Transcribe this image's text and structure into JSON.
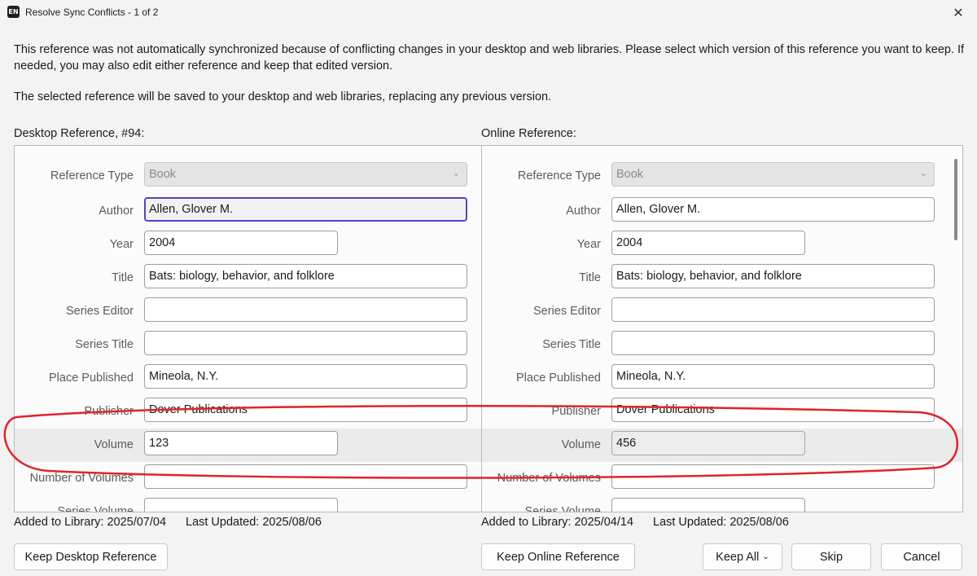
{
  "window": {
    "app_icon": "EN",
    "title": "Resolve Sync Conflicts - 1 of 2",
    "close_glyph": "✕"
  },
  "intro": {
    "paragraph1": "This reference was not automatically synchronized because of conflicting changes in your desktop and web libraries. Please select which version of this reference you want to keep. If needed, you may also edit either reference and keep that edited version.",
    "paragraph2": "The selected reference will be saved to your desktop and web libraries, replacing any previous version."
  },
  "desktop": {
    "header": "Desktop Reference, #94:",
    "fields": {
      "reference_type": {
        "label": "Reference Type",
        "value": "Book"
      },
      "author": {
        "label": "Author",
        "value": "Allen, Glover M."
      },
      "year": {
        "label": "Year",
        "value": "2004"
      },
      "title": {
        "label": "Title",
        "value": "Bats: biology, behavior, and folklore"
      },
      "series_editor": {
        "label": "Series Editor",
        "value": ""
      },
      "series_title": {
        "label": "Series Title",
        "value": ""
      },
      "place_published": {
        "label": "Place Published",
        "value": "Mineola, N.Y."
      },
      "publisher": {
        "label": "Publisher",
        "value": "Dover Publications"
      },
      "volume": {
        "label": "Volume",
        "value": "123"
      },
      "number_of_volumes": {
        "label": "Number of Volumes",
        "value": ""
      },
      "series_volume": {
        "label": "Series Volume",
        "value": ""
      }
    },
    "added": "Added to Library: 2025/07/04",
    "updated": "Last Updated: 2025/08/06"
  },
  "online": {
    "header": "Online Reference:",
    "fields": {
      "reference_type": {
        "label": "Reference Type",
        "value": "Book"
      },
      "author": {
        "label": "Author",
        "value": "Allen, Glover M."
      },
      "year": {
        "label": "Year",
        "value": "2004"
      },
      "title": {
        "label": "Title",
        "value": "Bats: biology, behavior, and folklore"
      },
      "series_editor": {
        "label": "Series Editor",
        "value": ""
      },
      "series_title": {
        "label": "Series Title",
        "value": ""
      },
      "place_published": {
        "label": "Place Published",
        "value": "Mineola, N.Y."
      },
      "publisher": {
        "label": "Publisher",
        "value": "Dover Publications"
      },
      "volume": {
        "label": "Volume",
        "value": "456"
      },
      "number_of_volumes": {
        "label": "Number of Volumes",
        "value": ""
      },
      "series_volume": {
        "label": "Series Volume",
        "value": ""
      }
    },
    "added": "Added to Library: 2025/04/14",
    "updated": "Last Updated: 2025/08/06"
  },
  "buttons": {
    "keep_desktop": "Keep Desktop Reference",
    "keep_online": "Keep Online Reference",
    "keep_all": "Keep All",
    "skip": "Skip",
    "cancel": "Cancel"
  },
  "colors": {
    "annotation": "#e0232a",
    "focus": "#5b3fc9"
  }
}
